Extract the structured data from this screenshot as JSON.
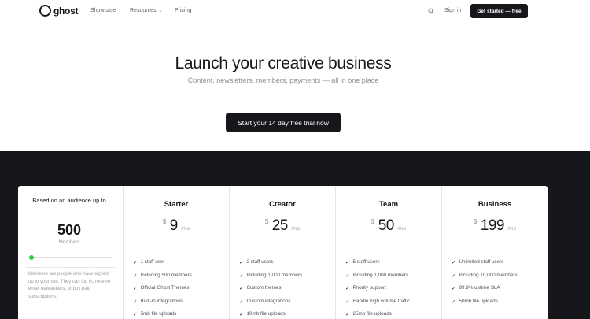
{
  "nav": {
    "logo_text": "ghost",
    "links": [
      "Showcase",
      "Resources",
      "Pricing"
    ],
    "resources_chevron": "chevron-down-icon",
    "search_icon": "search-icon",
    "sign_in": "Sign in",
    "cta": "Get started — free"
  },
  "hero": {
    "title": "Launch your creative business",
    "subtitle": "Content, newsletters, members, payments — all in one place",
    "cta": "Start your 14 day free trial now"
  },
  "audience": {
    "heading": "Based on an audience up to",
    "count": "500",
    "unit": "Members",
    "slider_fraction": 0.0,
    "description": "Members are people who have signed up to your site. They can log in, receive email newsletters, or buy paid subscriptions."
  },
  "plans": [
    {
      "name": "Starter",
      "currency": "$",
      "price": "9",
      "period": "/mo",
      "features": [
        "1 staff user",
        "Including 500 members",
        "Official Ghost Themes",
        "Built-in integrations",
        "5mb file uploads"
      ]
    },
    {
      "name": "Creator",
      "currency": "$",
      "price": "25",
      "period": "/mo",
      "features": [
        "2 staff users",
        "Including 1,000 members",
        "Custom themes",
        "Custom integrations",
        "10mb file uploads"
      ]
    },
    {
      "name": "Team",
      "currency": "$",
      "price": "50",
      "period": "/mo",
      "features": [
        "5 staff users",
        "Including 1,000 members",
        "Priority support",
        "Handle high volume traffic",
        "25mb file uploads"
      ]
    },
    {
      "name": "Business",
      "currency": "$",
      "price": "199",
      "period": "/mo",
      "features": [
        "Unlimited staff users",
        "Including 10,000 members",
        "99.9% uptime SLA",
        "50mb file uploads"
      ]
    }
  ],
  "colors": {
    "dark": "#15171a",
    "accent_green": "#30cf43"
  }
}
